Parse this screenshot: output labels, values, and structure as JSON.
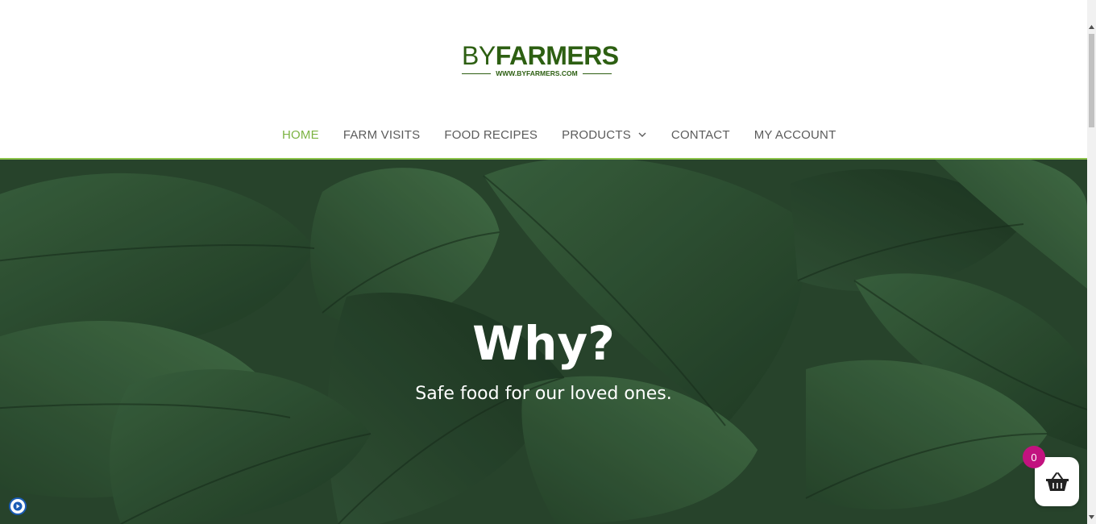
{
  "brand": {
    "name_prefix": "BY",
    "name_main": "FARMERS",
    "url": "WWW.BYFARMERS.COM",
    "color": "#2d5f12"
  },
  "nav": {
    "items": [
      {
        "label": "HOME",
        "active": true
      },
      {
        "label": "FARM VISITS",
        "active": false
      },
      {
        "label": "FOOD RECIPES",
        "active": false
      },
      {
        "label": "PRODUCTS",
        "active": false,
        "has_dropdown": true
      },
      {
        "label": "CONTACT",
        "active": false
      },
      {
        "label": "MY ACCOUNT",
        "active": false
      }
    ],
    "active_color": "#7cb342",
    "text_color": "#5b5b5b"
  },
  "hero": {
    "title": "Why?",
    "subtitle": "Safe food for our loved ones.",
    "background": "dark green hosta leaves"
  },
  "cart": {
    "count": "0",
    "icon": "basket-icon",
    "badge_color": "#c2127f"
  },
  "accessibility": {
    "icon": "play-circle-icon"
  },
  "scrollbar": {
    "icon_up": "triangle-up-icon",
    "icon_down": "triangle-down-icon"
  }
}
